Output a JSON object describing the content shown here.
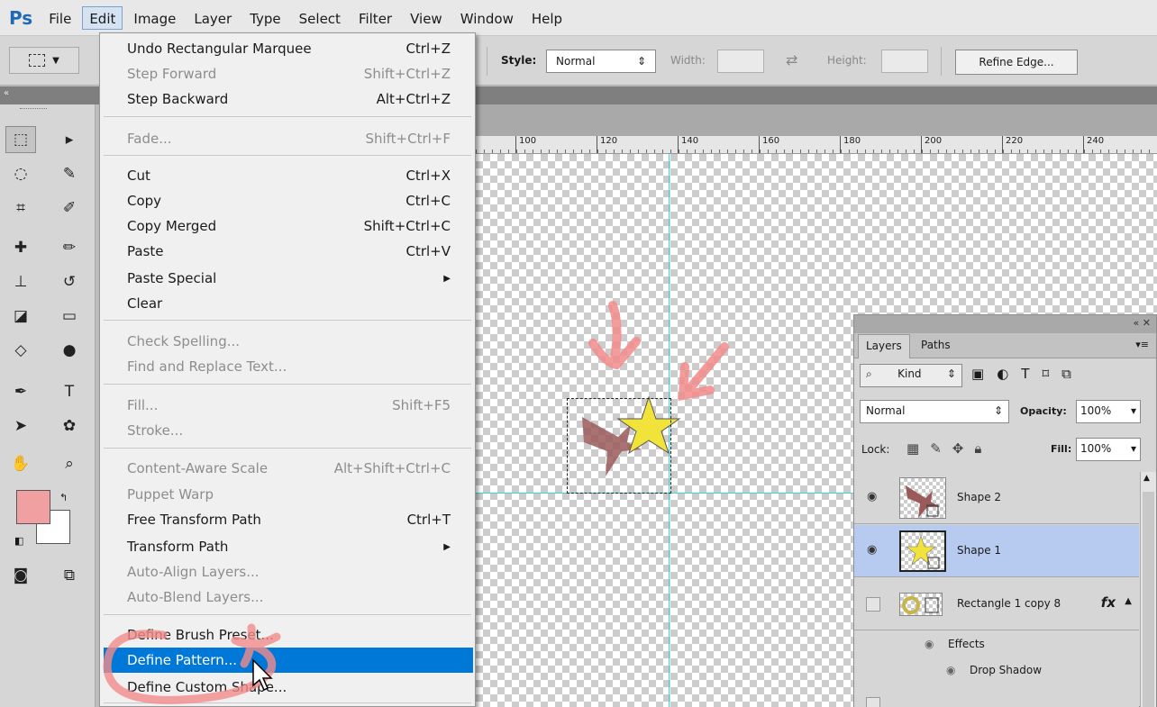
{
  "app": {
    "logo": "Ps"
  },
  "menubar": [
    "File",
    "Edit",
    "Image",
    "Layer",
    "Type",
    "Select",
    "Filter",
    "View",
    "Window",
    "Help"
  ],
  "options": {
    "style_label": "Style:",
    "style_value": "Normal",
    "width_label": "Width:",
    "height_label": "Height:",
    "refine_edge": "Refine Edge..."
  },
  "ruler": [
    "100",
    "120",
    "140",
    "160",
    "180",
    "200",
    "220",
    "240"
  ],
  "edit_menu": [
    {
      "label": "Undo Rectangular Marquee",
      "shortcut": "Ctrl+Z",
      "state": "enabled"
    },
    {
      "label": "Step Forward",
      "shortcut": "Shift+Ctrl+Z",
      "state": "disabled"
    },
    {
      "label": "Step Backward",
      "shortcut": "Alt+Ctrl+Z",
      "state": "enabled"
    },
    {
      "label": "Fade...",
      "shortcut": "Shift+Ctrl+F",
      "state": "disabled"
    },
    {
      "label": "Cut",
      "shortcut": "Ctrl+X",
      "state": "enabled"
    },
    {
      "label": "Copy",
      "shortcut": "Ctrl+C",
      "state": "enabled"
    },
    {
      "label": "Copy Merged",
      "shortcut": "Shift+Ctrl+C",
      "state": "enabled"
    },
    {
      "label": "Paste",
      "shortcut": "Ctrl+V",
      "state": "enabled"
    },
    {
      "label": "Paste Special",
      "shortcut": "",
      "state": "enabled"
    },
    {
      "label": "Clear",
      "shortcut": "",
      "state": "enabled"
    },
    {
      "label": "Check Spelling...",
      "shortcut": "",
      "state": "disabled"
    },
    {
      "label": "Find and Replace Text...",
      "shortcut": "",
      "state": "disabled"
    },
    {
      "label": "Fill...",
      "shortcut": "Shift+F5",
      "state": "disabled"
    },
    {
      "label": "Stroke...",
      "shortcut": "",
      "state": "disabled"
    },
    {
      "label": "Content-Aware Scale",
      "shortcut": "Alt+Shift+Ctrl+C",
      "state": "disabled"
    },
    {
      "label": "Puppet Warp",
      "shortcut": "",
      "state": "disabled"
    },
    {
      "label": "Free Transform Path",
      "shortcut": "Ctrl+T",
      "state": "enabled"
    },
    {
      "label": "Transform Path",
      "shortcut": "",
      "state": "enabled"
    },
    {
      "label": "Auto-Align Layers...",
      "shortcut": "",
      "state": "disabled"
    },
    {
      "label": "Auto-Blend Layers...",
      "shortcut": "",
      "state": "disabled"
    },
    {
      "label": "Define Brush Preset...",
      "shortcut": "",
      "state": "enabled"
    },
    {
      "label": "Define Pattern...",
      "shortcut": "",
      "state": "highlighted"
    },
    {
      "label": "Define Custom Shape...",
      "shortcut": "",
      "state": "enabled"
    }
  ],
  "layers_panel": {
    "tabs": [
      "Layers",
      "Paths"
    ],
    "kind": "Kind",
    "blend_mode": "Normal",
    "opacity_label": "Opacity:",
    "opacity_value": "100%",
    "lock_label": "Lock:",
    "fill_label": "Fill:",
    "fill_value": "100%",
    "layers": [
      {
        "name": "Shape 2",
        "visible": true,
        "selected": false
      },
      {
        "name": "Shape 1",
        "visible": true,
        "selected": true
      },
      {
        "name": "Rectangle 1 copy 8",
        "visible": false,
        "selected": false,
        "fx": "fx"
      }
    ],
    "effects_label": "Effects",
    "drop_shadow_label": "Drop Shadow"
  },
  "colors": {
    "foreground": "#f0a0a0",
    "background": "#ffffff",
    "highlight": "#0078d7",
    "guide": "#35d9d9",
    "star": "#f2e33b",
    "plane": "#9a5a5a",
    "annotation": "#f28b8b"
  }
}
